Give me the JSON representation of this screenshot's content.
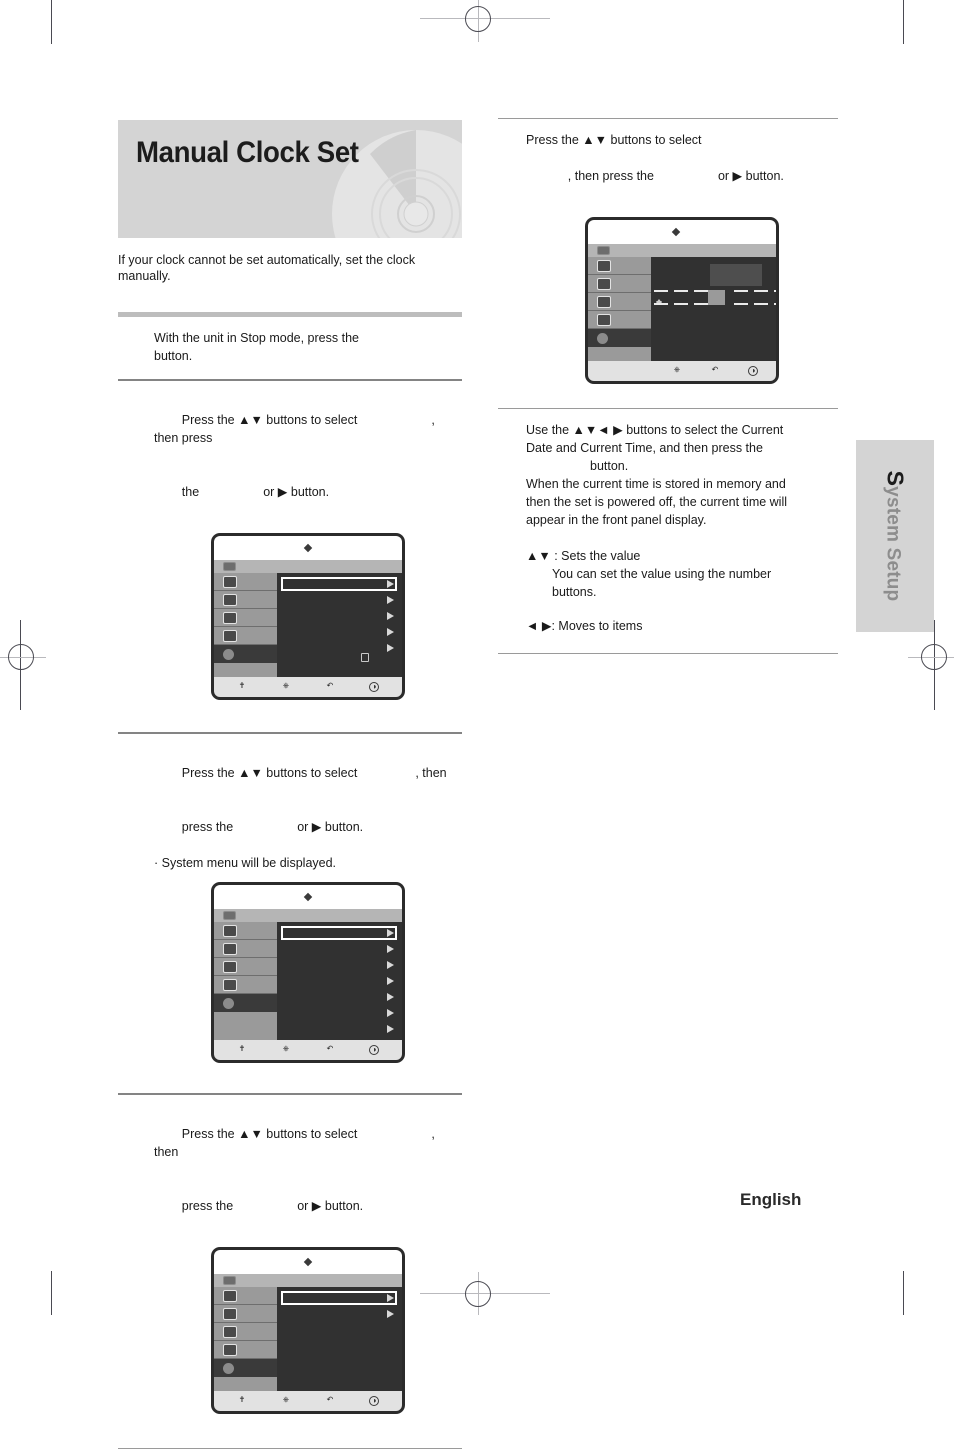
{
  "document": {
    "title": "Manual Clock Set",
    "intro": "If your clock cannot be set automatically, set the clock manually.",
    "language": "English",
    "side_tab": {
      "cap": "S",
      "rest": "ystem Setup"
    }
  },
  "left_column": {
    "steps": [
      {
        "id": "step-1",
        "lines": [
          "With the unit in Stop mode, press the",
          "button."
        ]
      },
      {
        "id": "step-2",
        "line_a_pre": "Press the ▲▼ buttons to select",
        "line_a_post": ", then press",
        "line_b_pre": "the",
        "line_b_post": "or ▶ button.",
        "note": ""
      },
      {
        "id": "step-3",
        "line_a_pre": "Press the ▲▼ buttons to select",
        "line_a_post": ", then",
        "line_b_pre": "press the",
        "line_b_post": "or ▶ button.",
        "note": "· System menu will be displayed."
      },
      {
        "id": "step-4",
        "line_a_pre": "Press the ▲▼ buttons to select",
        "line_a_post": ", then",
        "line_b_pre": "press the",
        "line_b_post": "or ▶ button.",
        "note": ""
      }
    ]
  },
  "right_column": {
    "step_5": {
      "line_a": "Press the ▲▼ buttons to select",
      "line_b_pre": ", then press the",
      "line_b_post": "or ▶ button."
    },
    "step_6": {
      "lines": [
        "Use the ▲▼◄ ▶ buttons to select the Current",
        "Date and Current Time, and then press the",
        "button.",
        "When the current time is stored in memory and",
        "then the set is powered off, the current time will",
        "appear in the front panel display."
      ],
      "key_notes": [
        {
          "keys": "▲▼",
          "text": " : Sets the value"
        },
        {
          "keys": "",
          "text": "You can set the value using the number"
        },
        {
          "keys": "",
          "text": "buttons."
        },
        {
          "keys": "◄ ▶",
          "text": ": Moves to items"
        }
      ]
    }
  },
  "osd_menus": [
    {
      "id": "osd-menu-1",
      "sidebar_icons": [
        "film-strip-icon",
        "music-note-icon",
        "audio-speaker-icon",
        "display-picture-icon",
        "gear-settings-icon"
      ],
      "selected_sidebar_index": 4,
      "item_count": 5,
      "highlight_index": 0,
      "has_lock_icon": true,
      "footer_icons": [
        "move-icon",
        "select-icon",
        "return-icon",
        "exit-icon"
      ]
    },
    {
      "id": "osd-menu-2",
      "sidebar_icons": [
        "film-strip-icon",
        "music-note-icon",
        "audio-speaker-icon",
        "display-picture-icon",
        "gear-settings-icon"
      ],
      "selected_sidebar_index": 4,
      "item_count": 7,
      "highlight_index": 0,
      "has_lock_icon": false,
      "footer_icons": [
        "move-icon",
        "select-icon",
        "return-icon",
        "exit-icon"
      ]
    },
    {
      "id": "osd-menu-3",
      "sidebar_icons": [
        "film-strip-icon",
        "music-note-icon",
        "audio-speaker-icon",
        "display-picture-icon",
        "gear-settings-icon"
      ],
      "selected_sidebar_index": 4,
      "item_count": 2,
      "highlight_index": 0,
      "has_lock_icon": false,
      "footer_icons": [
        "move-icon",
        "select-icon",
        "return-icon",
        "exit-icon"
      ]
    },
    {
      "id": "osd-menu-4-clock",
      "sidebar_icons": [
        "film-strip-icon",
        "music-note-icon",
        "audio-speaker-icon",
        "display-picture-icon",
        "gear-settings-icon"
      ],
      "selected_sidebar_index": 4,
      "item_count": 0,
      "highlight_index": -1,
      "has_lock_icon": false,
      "clock_fields": 7,
      "clock_selected_field": 3,
      "footer_icons": [
        "select-icon",
        "return-icon",
        "exit-icon"
      ]
    }
  ],
  "colors": {
    "banner_bg": "#d4d4d4",
    "rule_thick": "#bdbdbd",
    "rule_thin": "#848484",
    "osd_dark": "#313131",
    "osd_sidebar": "#9a9a9a",
    "osd_footer": "#e2e2e2",
    "text": "#1a1a1a"
  }
}
